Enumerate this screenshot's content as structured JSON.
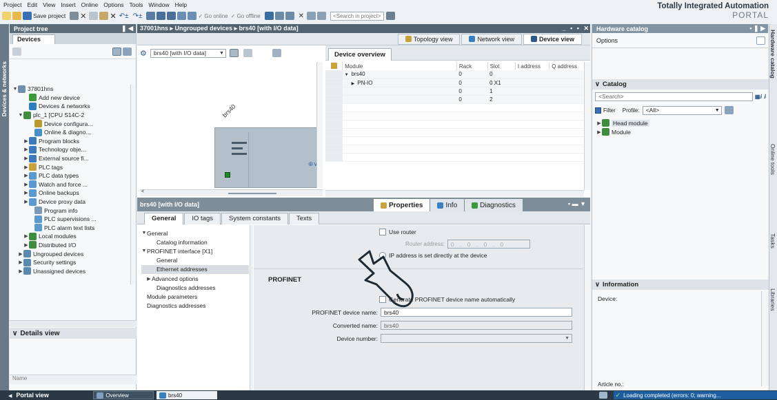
{
  "menu": [
    "Project",
    "Edit",
    "View",
    "Insert",
    "Online",
    "Options",
    "Tools",
    "Window",
    "Help"
  ],
  "toolbar": {
    "save_label": "Save project",
    "go_online": "Go online",
    "go_offline": "Go offline",
    "search_placeholder": "<Search in project>"
  },
  "brand": {
    "line1": "Totally Integrated Automation",
    "line2": "PORTAL"
  },
  "project_tree": {
    "title": "Project tree",
    "tab": "Devices",
    "side_label": "Devices & networks",
    "items": [
      {
        "label": "37801hns",
        "indent": 0,
        "arrow": "▼",
        "color": "#6f8fb0"
      },
      {
        "label": "Add new device",
        "indent": 2,
        "arrow": "",
        "color": "#3a9a3a"
      },
      {
        "label": "Devices & networks",
        "indent": 2,
        "arrow": "",
        "color": "#2f7fc0"
      },
      {
        "label": "plc_1 [CPU S14C-2",
        "indent": 1,
        "arrow": "▼",
        "color": "#3f8c3f"
      },
      {
        "label": "Device configura...",
        "indent": 3,
        "arrow": "",
        "color": "#b89a30"
      },
      {
        "label": "Online & diagno...",
        "indent": 3,
        "arrow": "",
        "color": "#4a8fc8"
      },
      {
        "label": "Program blocks",
        "indent": 2,
        "arrow": "▶",
        "color": "#3b7bbd"
      },
      {
        "label": "Technology obje...",
        "indent": 2,
        "arrow": "▶",
        "color": "#3b7bbd"
      },
      {
        "label": "External source fi...",
        "indent": 2,
        "arrow": "▶",
        "color": "#3b7bbd"
      },
      {
        "label": "PLC tags",
        "indent": 2,
        "arrow": "▶",
        "color": "#c8a23a"
      },
      {
        "label": "PLC data types",
        "indent": 2,
        "arrow": "▶",
        "color": "#5a9ad0"
      },
      {
        "label": "Watch and force ...",
        "indent": 2,
        "arrow": "▶",
        "color": "#5a9ad0"
      },
      {
        "label": "Online backups",
        "indent": 2,
        "arrow": "▶",
        "color": "#5a9ad0"
      },
      {
        "label": "Device proxy data",
        "indent": 2,
        "arrow": "▶",
        "color": "#5a9ad0"
      },
      {
        "label": "Program info",
        "indent": 3,
        "arrow": "",
        "color": "#7a9ab8"
      },
      {
        "label": "PLC supervisions ...",
        "indent": 3,
        "arrow": "",
        "color": "#5a9ad0"
      },
      {
        "label": "PLC alarm text lists",
        "indent": 3,
        "arrow": "",
        "color": "#5a9ad0"
      },
      {
        "label": "Local modules",
        "indent": 2,
        "arrow": "▶",
        "color": "#3f8c3f"
      },
      {
        "label": "Distributed I/O",
        "indent": 2,
        "arrow": "▶",
        "color": "#3f8c3f"
      },
      {
        "label": "Ungrouped devices",
        "indent": 1,
        "arrow": "▶",
        "color": "#5a8ab0"
      },
      {
        "label": "Security settings",
        "indent": 1,
        "arrow": "▶",
        "color": "#5a8ab0"
      },
      {
        "label": "Unassigned devices",
        "indent": 1,
        "arrow": "▶",
        "color": "#5a8ab0"
      }
    ],
    "details_title": "Details view",
    "details_col": "Name"
  },
  "editor": {
    "breadcrumb": "37001hns  ▸  Ungrouped devices  ▸  brs40 [with I/O data]",
    "views": [
      "Topology view",
      "Network view",
      "Device view"
    ],
    "device_select": "brs40 [with I/O data]",
    "device_label": "brs40",
    "overview_tab": "Device overview",
    "overview_columns": [
      "Module",
      "Rack",
      "Slot",
      "I address",
      "Q address"
    ],
    "overview_rows": [
      {
        "module": "brs40",
        "arrow": "▼",
        "indent": 0,
        "rack": "0",
        "slot": "0"
      },
      {
        "module": "PN-IO",
        "arrow": "▶",
        "indent": 1,
        "rack": "0",
        "slot": "0 X1"
      },
      {
        "module": "",
        "arrow": "",
        "indent": 0,
        "rack": "0",
        "slot": "1"
      },
      {
        "module": "",
        "arrow": "",
        "indent": 0,
        "rack": "0",
        "slot": "2"
      },
      {
        "module": "",
        "arrow": "",
        "indent": 0,
        "rack": "",
        "slot": ""
      },
      {
        "module": "",
        "arrow": "",
        "indent": 0,
        "rack": "",
        "slot": ""
      },
      {
        "module": "",
        "arrow": "",
        "indent": 0,
        "rack": "",
        "slot": ""
      },
      {
        "module": "",
        "arrow": "",
        "indent": 0,
        "rack": "",
        "slot": ""
      },
      {
        "module": "",
        "arrow": "",
        "indent": 0,
        "rack": "",
        "slot": ""
      },
      {
        "module": "",
        "arrow": "",
        "indent": 0,
        "rack": "",
        "slot": ""
      },
      {
        "module": "",
        "arrow": "",
        "indent": 0,
        "rack": "",
        "slot": ""
      }
    ]
  },
  "properties": {
    "title": "brs40 [with I/O data]",
    "main_tabs": [
      "Properties",
      "Info",
      "Diagnostics"
    ],
    "tabs": [
      "General",
      "IO tags",
      "System constants",
      "Texts"
    ],
    "nav": [
      {
        "label": "General",
        "indent": 0,
        "arrow": "▼",
        "selected": false
      },
      {
        "label": "Catalog information",
        "indent": 2,
        "arrow": "",
        "selected": false
      },
      {
        "label": "PROFINET interface [X1]",
        "indent": 0,
        "arrow": "▼",
        "selected": false
      },
      {
        "label": "General",
        "indent": 2,
        "arrow": "",
        "selected": false
      },
      {
        "label": "Ethernet addresses",
        "indent": 2,
        "arrow": "",
        "selected": true
      },
      {
        "label": "Advanced options",
        "indent": 1,
        "arrow": "▶",
        "selected": false
      },
      {
        "label": "Diagnostics addresses",
        "indent": 2,
        "arrow": "",
        "selected": false
      },
      {
        "label": "Module parameters",
        "indent": 0,
        "arrow": "",
        "selected": false
      },
      {
        "label": "Diagnostics addresses",
        "indent": 0,
        "arrow": "",
        "selected": false
      }
    ],
    "use_router": "Use router",
    "router_address_label": "Router address:",
    "router_address_value": "0 . 0 . 0 . 0",
    "ip_direct": "IP address is set directly at the device",
    "profinet_section": "PROFINET",
    "generate_name": "Generate PROFINET device name automatically",
    "device_name_label": "PROFINET device name:",
    "device_name_value": "brs40",
    "converted_name_label": "Converted name:",
    "converted_name_value": "brs40",
    "device_number_label": "Device number:",
    "device_number_value": ""
  },
  "catalog": {
    "title": "Hardware catalog",
    "options": "Options",
    "section": "Catalog",
    "search_placeholder": "<Search>",
    "filter": "Filter",
    "profile_label": "Profile:",
    "profile_value": "<All>",
    "items": [
      "Head module",
      "Module"
    ],
    "information": "Information",
    "device_label": "Device:",
    "article_label": "Article no.:"
  },
  "side_tabs": [
    "Hardware catalog",
    "Online tools",
    "Tasks",
    "Libraries"
  ],
  "statusbar": {
    "portal_view": "Portal view",
    "overview": "Overview",
    "device": "brs40",
    "status": "Loading completed (errors: 0; warning..."
  }
}
